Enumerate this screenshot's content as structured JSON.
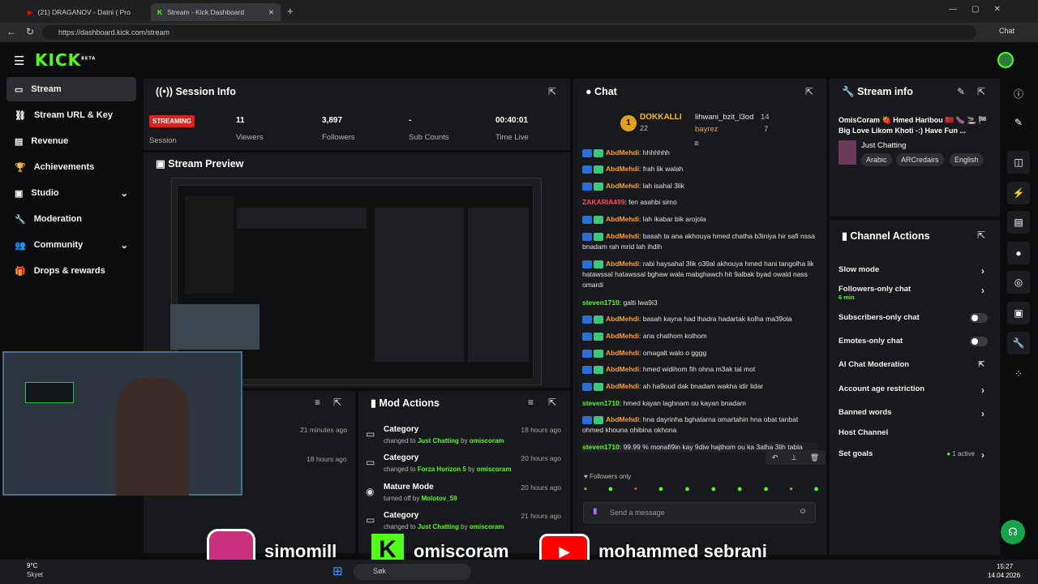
{
  "browser": {
    "tab1": "(21) DRAGANOV - Datni ( Pro",
    "tab2": "Stream - Kick Dashboard",
    "url": "https://dashboard.kick.com/stream",
    "chat_btn": "Chat"
  },
  "brand": {
    "logo": "KICK",
    "beta": "BETA",
    "accent": "#53fc18"
  },
  "sidebar": {
    "items": [
      {
        "label": "Stream"
      },
      {
        "label": "Stream URL & Key"
      },
      {
        "label": "Revenue"
      },
      {
        "label": "Achievements"
      },
      {
        "label": "Studio"
      },
      {
        "label": "Moderation"
      },
      {
        "label": "Community"
      },
      {
        "label": "Drops & rewards"
      }
    ]
  },
  "session": {
    "title": "Session Info",
    "status": "STREAMING",
    "status_label": "Session",
    "viewers": "11",
    "viewers_label": "Viewers",
    "followers": "3,897",
    "followers_label": "Followers",
    "subs": "-",
    "subs_label": "Sub Counts",
    "time": "00:40:01",
    "time_label": "Time Live"
  },
  "preview": {
    "title": "Stream Preview"
  },
  "recent": {
    "t1": "21 minutes ago",
    "t2": "18 hours ago"
  },
  "mod": {
    "title": "Mod Actions",
    "items": [
      {
        "title": "Category",
        "prefix": "changed to",
        "value": "Just Chatting",
        "by": "by",
        "user": "omiscoram",
        "time": "18 hours ago"
      },
      {
        "title": "Category",
        "prefix": "changed to",
        "value": "Forza Horizon 5",
        "by": "by",
        "user": "omiscoram",
        "time": "20 hours ago"
      },
      {
        "title": "Mature Mode",
        "prefix": "turned off",
        "value": "",
        "by": "by",
        "user": "Molotov_59",
        "time": "20 hours ago"
      },
      {
        "title": "Category",
        "prefix": "changed to",
        "value": "Just Chatting",
        "by": "by",
        "user": "omiscoram",
        "time": "21 hours ago"
      }
    ]
  },
  "chat": {
    "title": "Chat",
    "top1_name": "DOKKALLI",
    "top1_count": "22",
    "top2_name": "lihwani_bzit_l3od",
    "top2_count": "14",
    "top3_name": "bayrez",
    "top3_count": "7",
    "messages": [
      {
        "user": "AbdMehdi",
        "text": ": hhhhhhh"
      },
      {
        "user": "AbdMehdi",
        "text": ": frah lik walah"
      },
      {
        "user": "AbdMehdi",
        "text": ": lah isahal 3lik"
      },
      {
        "user": "ZAKARIA499",
        "text": ": fen asahbi simo"
      },
      {
        "user": "AbdMehdi",
        "text": ": lah ikabar bik arojola"
      },
      {
        "user": "AbdMehdi",
        "text": ": basah ta ana akhouya hmed chatha b3iniya hir safi nssa bnadam rah mrid lah ihdih"
      },
      {
        "user": "AbdMehdi",
        "text": ": rabi haysahal 3lik o39al akhouya hmed hani tangolha lik hatawssal hatawssal bghaw wala mabghawch hit 9albak byad owald nass omardi"
      },
      {
        "user": "steven1710",
        "text": ": galti lwa9i3"
      },
      {
        "user": "AbdMehdi",
        "text": ": basah kayna had lhadra hadartak kolha ma39ola"
      },
      {
        "user": "AbdMehdi",
        "text": ": ana chathom kolhom"
      },
      {
        "user": "AbdMehdi",
        "text": ": omagalt walo o gggg"
      },
      {
        "user": "AbdMehdi",
        "text": ": hmed widihom fih ohna m3ak tal mot"
      },
      {
        "user": "AbdMehdi",
        "text": ": ah ha9oud dak bnadam wakha idir lidar"
      },
      {
        "user": "steven1710",
        "text": ": hmed kayan laghnam ou kayan bnadam"
      },
      {
        "user": "AbdMehdi",
        "text": ": hna dayrinha bghatarna omartahin hna obat tanbat ohmed khouna ohibina okhona"
      },
      {
        "user": "steven1710",
        "text": ": 99.99 % monafi9in kay 9diw hajthom ou ka 3alha 3lih tabla"
      }
    ],
    "followers_only": "Followers only",
    "placeholder": "Send a message"
  },
  "streaminfo": {
    "title": "Stream info",
    "stream_title": "OmisCoram 🍓 Hmed Haribou 🇲🇦 🍆 🚬 🏁 Big Love Likom Khoti -:) Have Fun ...",
    "category": "Just Chatting",
    "tags": [
      "Arabic",
      "ARCredairs",
      "English"
    ]
  },
  "actions": {
    "title": "Channel Actions",
    "slow": "Slow mode",
    "fol": "Followers-only chat",
    "fol_sub": "6 min",
    "subs": "Subscribers-only chat",
    "emotes": "Emotes-only chat",
    "ai": "AI Chat Moderation",
    "age": "Account age restriction",
    "banned": "Banned words",
    "host": "Host Channel",
    "goals": "Set goals",
    "goals_status": "1 active"
  },
  "overlay": {
    "ig": "simomill",
    "kick": "omiscoram",
    "yt": "mohammed sebrani"
  },
  "taskbar": {
    "temp": "9°C",
    "weather": "Skyet",
    "search": "Søk",
    "time": "15:27",
    "date": "14.04.2026"
  }
}
